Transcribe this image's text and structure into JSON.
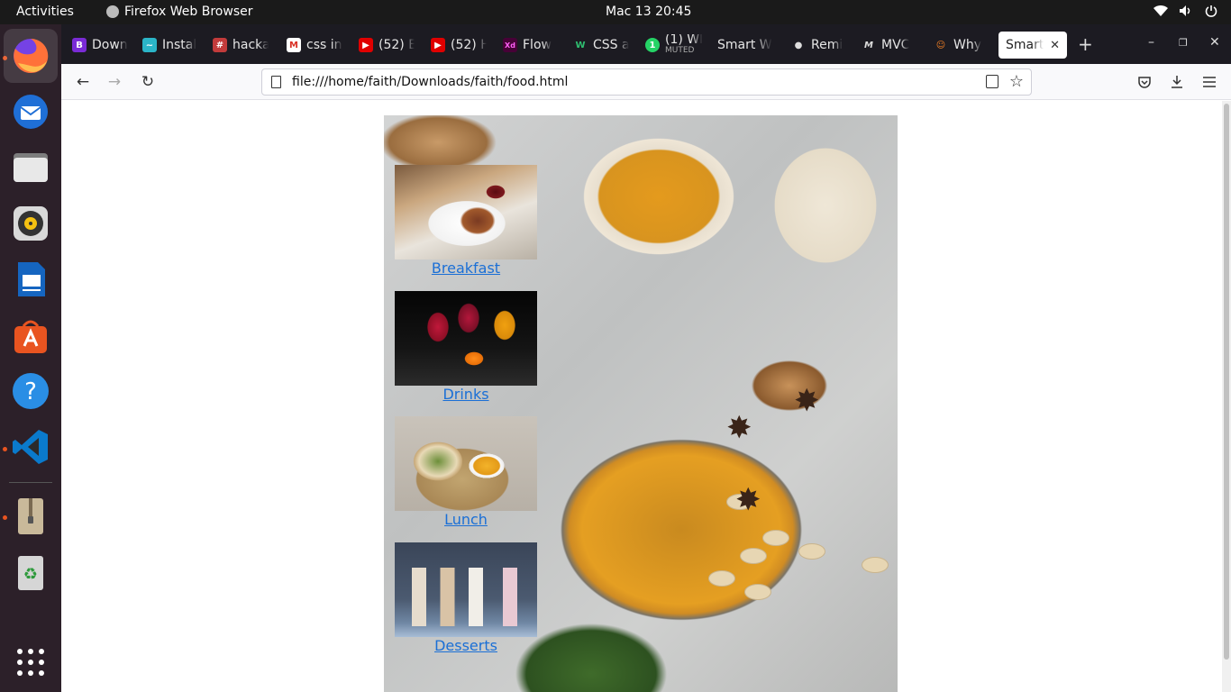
{
  "topbar": {
    "activities": "Activities",
    "app_name": "Firefox Web Browser",
    "clock": "Mac 13  20:45"
  },
  "dock": {
    "items": [
      "firefox",
      "thunderbird",
      "files",
      "rhythmbox",
      "libreoffice-writer",
      "ubuntu-software",
      "help",
      "vscode",
      "archive-manager",
      "trash",
      "show-applications"
    ]
  },
  "browser": {
    "tabs": [
      {
        "label": "Down",
        "favicon": "B",
        "color": "#7a2bd6"
      },
      {
        "label": "Instal",
        "favicon": "~",
        "color": "#2bb5c8"
      },
      {
        "label": "hacka",
        "favicon": "#",
        "color": "#c23b3b"
      },
      {
        "label": "css in",
        "favicon": "M",
        "color": "#d93025"
      },
      {
        "label": "(52) E",
        "favicon": "▶",
        "color": "#e00000"
      },
      {
        "label": "(52) H",
        "favicon": "▶",
        "color": "#e00000"
      },
      {
        "label": "Flow",
        "favicon": "Xd",
        "color": "#470137"
      },
      {
        "label": "CSS a",
        "favicon": "W",
        "color": "#1a8a4a"
      },
      {
        "label": "(1) Wl",
        "sublabel": "MUTED",
        "favicon": "1",
        "color": "#25d366"
      },
      {
        "label": "Smart W",
        "favicon": "",
        "color": "#1c1b22"
      },
      {
        "label": "Remi",
        "favicon": "●",
        "color": "#333"
      },
      {
        "label": "MVC",
        "favicon": "M",
        "color": "#222"
      },
      {
        "label": "Why",
        "favicon": "☺",
        "color": "#f48024"
      },
      {
        "label": "Smart",
        "favicon": "",
        "color": "#fff"
      }
    ],
    "url": "file:///home/faith/Downloads/faith/food.html"
  },
  "page": {
    "menu": [
      {
        "label": "Breakfast"
      },
      {
        "label": "Drinks"
      },
      {
        "label": "Lunch"
      },
      {
        "label": "Desserts"
      }
    ]
  }
}
